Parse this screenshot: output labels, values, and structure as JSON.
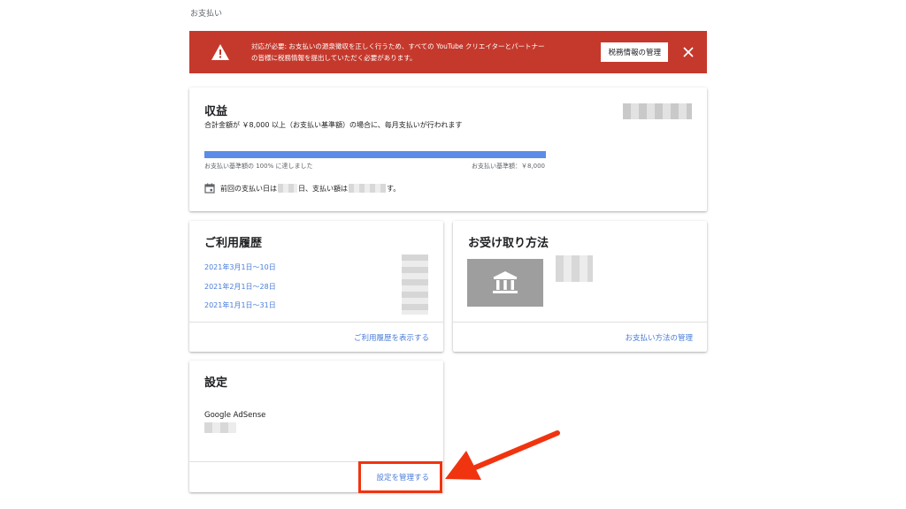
{
  "page": {
    "title": "お支払い"
  },
  "alert": {
    "text_line1": "対応が必要: お支払いの源泉徴収を正しく行うため、すべての YouTube クリエイターとパートナー",
    "text_line2": "の皆様に税務情報を提出していただく必要があります。",
    "button_label": "税務情報の管理",
    "icon": "warning-icon",
    "close_icon": "close-icon",
    "color": "#c5392c"
  },
  "revenue": {
    "title": "収益",
    "subtitle": "合計金額が ￥8,000 以上（お支払い基準額）の場合に、毎月支払いが行われます",
    "progress_percent": 100,
    "progress_left_label": "お支払い基準額の 100% に達しました",
    "progress_right_label": "お支払い基準額：￥8,000",
    "last_payment_prefix": "前回の支払い日は",
    "last_payment_mid": "日、支払い額は",
    "last_payment_suffix": "す。",
    "accent_color": "#5b8de8"
  },
  "history": {
    "title": "ご利用履歴",
    "items": [
      {
        "label": "2021年3月1日〜10日"
      },
      {
        "label": "2021年2月1日〜28日"
      },
      {
        "label": "2021年1月1日〜31日"
      }
    ],
    "footer_link": "ご利用履歴を表示する"
  },
  "payment_method": {
    "title": "お受け取り方法",
    "icon": "bank-icon",
    "footer_link": "お支払い方法の管理"
  },
  "settings": {
    "title": "設定",
    "label": "Google AdSense",
    "footer_link": "設定を管理する",
    "highlight_color": "#f0340f"
  }
}
